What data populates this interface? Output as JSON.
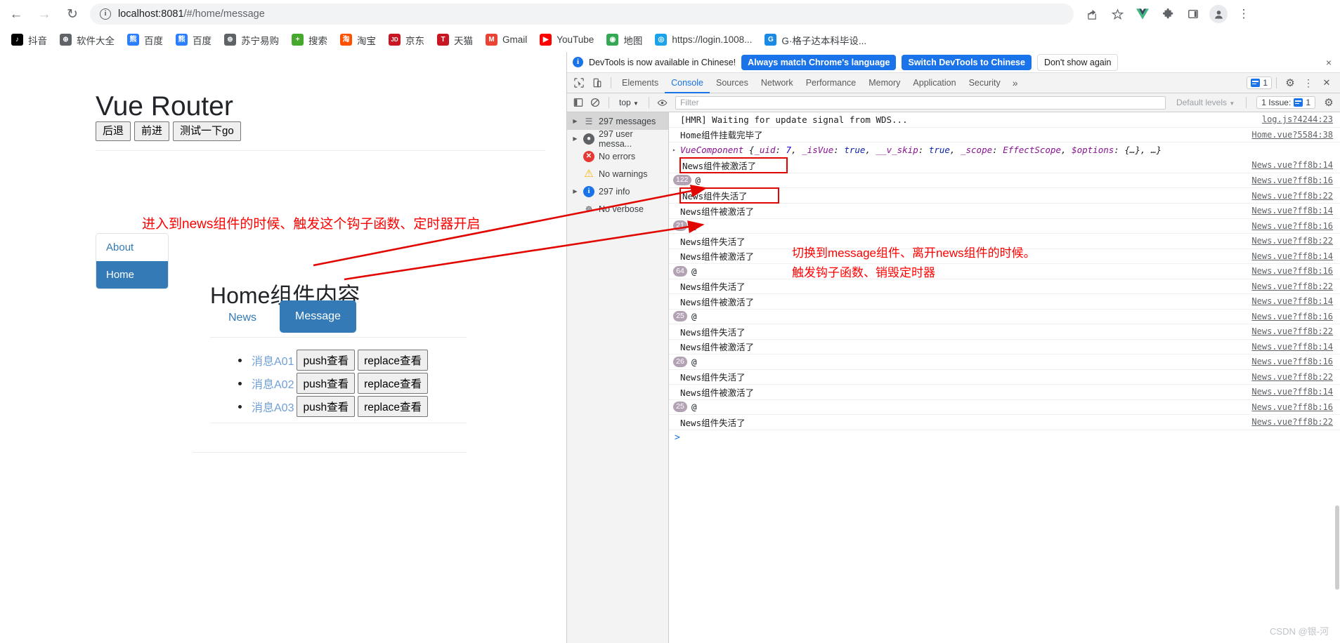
{
  "browser": {
    "nav": {
      "back": "←",
      "forward": "→",
      "reload": "↻"
    },
    "omnibox": {
      "url_host": "localhost:8081",
      "url_path": "/#/home/message",
      "info_icon": "i"
    },
    "toolbar_icons": [
      {
        "name": "share-icon",
        "glyph": "➦"
      },
      {
        "name": "bookmark-star-icon",
        "glyph": "☆"
      },
      {
        "name": "vue-devtools-extension-icon",
        "glyph": "V"
      },
      {
        "name": "extensions-puzzle-icon",
        "glyph": "✦"
      },
      {
        "name": "side-panel-icon",
        "glyph": "▢"
      },
      {
        "name": "profile-avatar-icon",
        "glyph": "●"
      },
      {
        "name": "chrome-menu-icon",
        "glyph": "⋮"
      }
    ],
    "bookmarks": [
      {
        "label": "抖音",
        "color": "#000000",
        "glyph": "♪"
      },
      {
        "label": "软件大全",
        "color": "#5f6368",
        "glyph": "⊕"
      },
      {
        "label": "百度",
        "color": "#2b7fff",
        "glyph": "熊"
      },
      {
        "label": "百度",
        "color": "#2b7fff",
        "glyph": "熊"
      },
      {
        "label": "苏宁易购",
        "color": "#5f6368",
        "glyph": "⊕"
      },
      {
        "label": "搜索",
        "color": "#46a82d",
        "glyph": "+"
      },
      {
        "label": "淘宝",
        "color": "#ff5000",
        "glyph": "淘"
      },
      {
        "label": "京东",
        "color": "#c81623",
        "glyph": "JD"
      },
      {
        "label": "天猫",
        "color": "#c81623",
        "glyph": "T"
      },
      {
        "label": "Gmail",
        "color": "#ea4335",
        "glyph": "M"
      },
      {
        "label": "YouTube",
        "color": "#ff0000",
        "glyph": "▶"
      },
      {
        "label": "地图",
        "color": "#34a853",
        "glyph": "◉"
      },
      {
        "label": "https://login.1008...",
        "color": "#1aa3e8",
        "glyph": "◎"
      },
      {
        "label": "G·格子达本科毕设...",
        "color": "#1a8ae5",
        "glyph": "G"
      }
    ]
  },
  "page": {
    "title": "Vue Router",
    "buttons": [
      {
        "label": "后退"
      },
      {
        "label": "前进"
      },
      {
        "label": "测试一下go"
      }
    ],
    "annotation_top": "进入到news组件的时候、触发这个钩子函数、定时器开启",
    "sidebar": [
      {
        "label": "About",
        "active": false
      },
      {
        "label": "Home",
        "active": true
      }
    ],
    "content_title": "Home组件内容",
    "tabs": [
      {
        "label": "News",
        "active": false
      },
      {
        "label": "Message",
        "active": true
      }
    ],
    "messages": [
      {
        "link": "消息A01",
        "push": "push查看",
        "replace": "replace查看"
      },
      {
        "link": "消息A02",
        "push": "push查看",
        "replace": "replace查看"
      },
      {
        "link": "消息A03",
        "push": "push查看",
        "replace": "replace查看"
      }
    ]
  },
  "devtools": {
    "infobar": {
      "message": "DevTools is now available in Chinese!",
      "btn_always": "Always match Chrome's language",
      "btn_switch": "Switch DevTools to Chinese",
      "btn_dismiss": "Don't show again",
      "close": "×"
    },
    "tabs": [
      {
        "label": "Elements",
        "active": false
      },
      {
        "label": "Console",
        "active": true
      },
      {
        "label": "Sources",
        "active": false
      },
      {
        "label": "Network",
        "active": false
      },
      {
        "label": "Performance",
        "active": false
      },
      {
        "label": "Memory",
        "active": false
      },
      {
        "label": "Application",
        "active": false
      },
      {
        "label": "Security",
        "active": false
      }
    ],
    "more_tabs": "»",
    "issue_count_top": "1",
    "settings_icon": "⚙",
    "kebab_icon": "⋮",
    "close_icon": "✕",
    "filterbar": {
      "context": "top",
      "filter_placeholder": "Filter",
      "levels": "Default levels",
      "issues_label": "1 Issue:",
      "issues_count": "1"
    },
    "sidebar": [
      {
        "label": "297 messages",
        "icon": "list-icon",
        "arrow": true,
        "selected": true
      },
      {
        "label": "297 user messa...",
        "icon": "user-icon",
        "arrow": true,
        "selected": false
      },
      {
        "label": "No errors",
        "icon": "error-icon",
        "arrow": false,
        "selected": false
      },
      {
        "label": "No warnings",
        "icon": "warning-icon",
        "arrow": false,
        "selected": false
      },
      {
        "label": "297 info",
        "icon": "info-icon",
        "arrow": true,
        "selected": false
      },
      {
        "label": "No verbose",
        "icon": "bug-icon",
        "arrow": false,
        "selected": false
      }
    ],
    "annotations": [
      "切换到message组件、离开news组件的时候。",
      "触发钩子函数、销毁定时器"
    ],
    "logs": [
      {
        "text": "[HMR] Waiting for update signal from WDS...",
        "src": "log.js?4244:23",
        "indent": 1
      },
      {
        "text": "Home组件挂载完毕了",
        "src": "Home.vue?5584:38",
        "indent": 1
      },
      {
        "object": true,
        "tri": "▸",
        "src": ""
      },
      {
        "text": "News组件被激活了",
        "src": "News.vue?ff8b:14",
        "indent": 1,
        "boxed": true
      },
      {
        "badge": "122",
        "text": "@",
        "src": "News.vue?ff8b:16",
        "indent": 0
      },
      {
        "text": "News组件失活了",
        "src": "News.vue?ff8b:22",
        "indent": 1,
        "boxed": true
      },
      {
        "text": "News组件被激活了",
        "src": "News.vue?ff8b:14",
        "indent": 1
      },
      {
        "badge": "21",
        "text": "@",
        "src": "News.vue?ff8b:16",
        "indent": 0
      },
      {
        "text": "News组件失活了",
        "src": "News.vue?ff8b:22",
        "indent": 1
      },
      {
        "text": "News组件被激活了",
        "src": "News.vue?ff8b:14",
        "indent": 1
      },
      {
        "badge": "64",
        "text": "@",
        "src": "News.vue?ff8b:16",
        "indent": 0
      },
      {
        "text": "News组件失活了",
        "src": "News.vue?ff8b:22",
        "indent": 1
      },
      {
        "text": "News组件被激活了",
        "src": "News.vue?ff8b:14",
        "indent": 1
      },
      {
        "badge": "25",
        "text": "@",
        "src": "News.vue?ff8b:16",
        "indent": 0
      },
      {
        "text": "News组件失活了",
        "src": "News.vue?ff8b:22",
        "indent": 1
      },
      {
        "text": "News组件被激活了",
        "src": "News.vue?ff8b:14",
        "indent": 1
      },
      {
        "badge": "26",
        "text": "@",
        "src": "News.vue?ff8b:16",
        "indent": 0
      },
      {
        "text": "News组件失活了",
        "src": "News.vue?ff8b:22",
        "indent": 1
      },
      {
        "text": "News组件被激活了",
        "src": "News.vue?ff8b:14",
        "indent": 1
      },
      {
        "badge": "25",
        "text": "@",
        "src": "News.vue?ff8b:16",
        "indent": 0
      },
      {
        "text": "News组件失活了",
        "src": "News.vue?ff8b:22",
        "indent": 1
      }
    ],
    "object_log": {
      "class": "VueComponent",
      "parts": [
        {
          "t": "{",
          "c": "plain"
        },
        {
          "t": "_uid",
          "c": "key"
        },
        {
          "t": ": ",
          "c": "plain"
        },
        {
          "t": "7",
          "c": "num"
        },
        {
          "t": ", ",
          "c": "plain"
        },
        {
          "t": "_isVue",
          "c": "key"
        },
        {
          "t": ": ",
          "c": "plain"
        },
        {
          "t": "true",
          "c": "bool"
        },
        {
          "t": ", ",
          "c": "plain"
        },
        {
          "t": "__v_skip",
          "c": "key"
        },
        {
          "t": ": ",
          "c": "plain"
        },
        {
          "t": "true",
          "c": "bool"
        },
        {
          "t": ", ",
          "c": "plain"
        },
        {
          "t": "_scope",
          "c": "key"
        },
        {
          "t": ": ",
          "c": "plain"
        },
        {
          "t": "EffectScope",
          "c": "class"
        },
        {
          "t": ", ",
          "c": "plain"
        },
        {
          "t": "$options",
          "c": "key"
        },
        {
          "t": ": ",
          "c": "plain"
        },
        {
          "t": "{…}",
          "c": "plain"
        },
        {
          "t": ", …}",
          "c": "plain"
        }
      ]
    },
    "prompt": ">"
  },
  "watermark": "CSDN @银-河",
  "colors": {
    "accent_blue": "#1a73e8",
    "vue_green": "#41b883",
    "annotation_red": "#fe0000",
    "bootstrap_blue": "#337ab7"
  }
}
